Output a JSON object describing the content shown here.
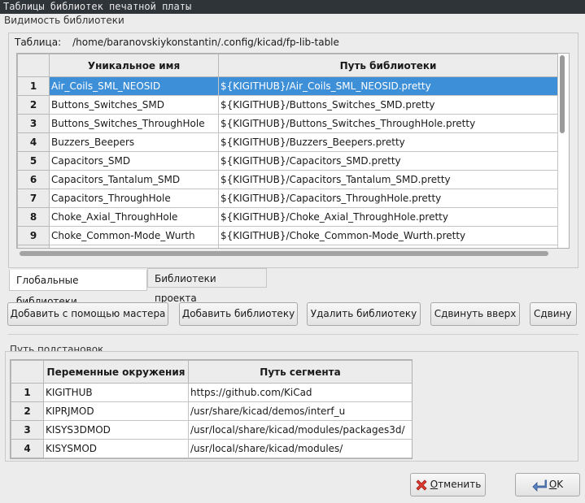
{
  "window": {
    "title": "Таблицы библиотек печатной платы"
  },
  "library_visibility": {
    "group_label": "Видимость библиотеки",
    "table_label": "Таблица:",
    "table_path": "/home/baranovskiykonstantin/.config/kicad/fp-lib-table",
    "columns": [
      "Уникальное имя",
      "Путь библиотеки"
    ],
    "rows": [
      {
        "num": "1",
        "nickname": "Air_Coils_SML_NEOSID",
        "path": "${KIGITHUB}/Air_Coils_SML_NEOSID.pretty",
        "selected": true
      },
      {
        "num": "2",
        "nickname": "Buttons_Switches_SMD",
        "path": "${KIGITHUB}/Buttons_Switches_SMD.pretty"
      },
      {
        "num": "3",
        "nickname": "Buttons_Switches_ThroughHole",
        "path": "${KIGITHUB}/Buttons_Switches_ThroughHole.pretty"
      },
      {
        "num": "4",
        "nickname": "Buzzers_Beepers",
        "path": "${KIGITHUB}/Buzzers_Beepers.pretty"
      },
      {
        "num": "5",
        "nickname": "Capacitors_SMD",
        "path": "${KIGITHUB}/Capacitors_SMD.pretty"
      },
      {
        "num": "6",
        "nickname": "Capacitors_Tantalum_SMD",
        "path": "${KIGITHUB}/Capacitors_Tantalum_SMD.pretty"
      },
      {
        "num": "7",
        "nickname": "Capacitors_ThroughHole",
        "path": "${KIGITHUB}/Capacitors_ThroughHole.pretty"
      },
      {
        "num": "8",
        "nickname": "Choke_Axial_ThroughHole",
        "path": "${KIGITHUB}/Choke_Axial_ThroughHole.pretty"
      },
      {
        "num": "9",
        "nickname": "Choke_Common-Mode_Wurth",
        "path": "${KIGITHUB}/Choke_Common-Mode_Wurth.pretty"
      }
    ],
    "tabs": {
      "global": "Глобальные библиотеки",
      "project": "Библиотеки проекта"
    }
  },
  "buttons": {
    "wizard": "Добавить с помощью мастера",
    "add": "Добавить библиотеку",
    "remove": "Удалить библиотеку",
    "move_up": "Сдвинуть вверх",
    "move_down": "Сдвину"
  },
  "substitutions": {
    "group_label": "Путь подстановок",
    "columns": [
      "Переменные окружения",
      "Путь сегмента"
    ],
    "rows": [
      {
        "num": "1",
        "var": "KIGITHUB",
        "path": "https://github.com/KiCad"
      },
      {
        "num": "2",
        "var": "KIPRJMOD",
        "path": "/usr/share/kicad/demos/interf_u"
      },
      {
        "num": "3",
        "var": "KISYS3DMOD",
        "path": "/usr/local/share/kicad/modules/packages3d/"
      },
      {
        "num": "4",
        "var": "KISYSMOD",
        "path": "/usr/local/share/kicad/modules/"
      }
    ]
  },
  "dialog_buttons": {
    "cancel_pre": "",
    "cancel_accel": "О",
    "cancel_post": "тменить",
    "ok_pre": "",
    "ok_accel": "O",
    "ok_post": "K"
  },
  "colors": {
    "selection": "#3d8fd8",
    "titlebar": "#2f3439"
  }
}
